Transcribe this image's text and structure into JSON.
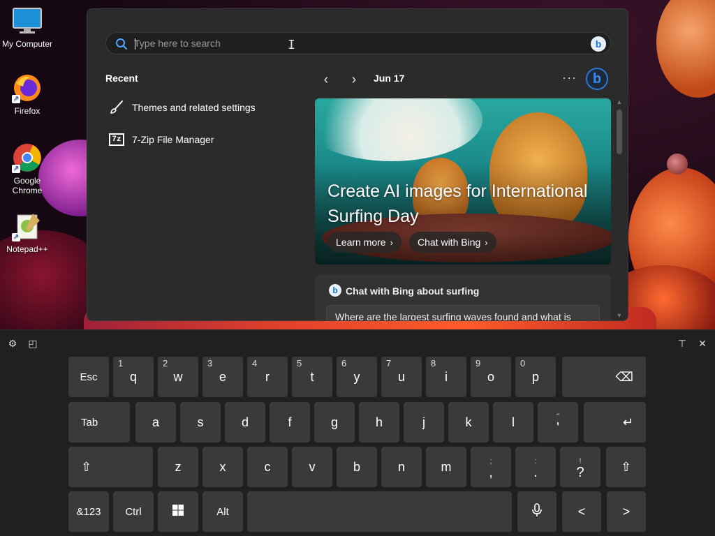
{
  "desktop": {
    "icons": [
      {
        "label": "My Computer"
      },
      {
        "label": "Firefox"
      },
      {
        "label": "Google Chrome"
      },
      {
        "label": "Notepad++"
      }
    ]
  },
  "start_menu": {
    "search": {
      "placeholder": "Type here to search",
      "value": ""
    },
    "recent": {
      "title": "Recent",
      "items": [
        {
          "label": "Themes and related settings",
          "icon": "brush-icon"
        },
        {
          "label": "7-Zip File Manager",
          "icon": "7zip-icon",
          "icon_text": "7z"
        }
      ]
    },
    "highlights": {
      "date": "Jun 17",
      "more_label": "···",
      "hero": {
        "title": "Create AI images for International Surfing Day",
        "learn_more": "Learn more",
        "chat_with_bing": "Chat with Bing"
      },
      "chat_card": {
        "title": "Chat with Bing about surfing",
        "prompt": "Where are the largest surfing waves found and what is"
      }
    }
  },
  "keyboard": {
    "row1": [
      {
        "label": "Esc"
      },
      {
        "label": "q",
        "sub": "1"
      },
      {
        "label": "w",
        "sub": "2"
      },
      {
        "label": "e",
        "sub": "3"
      },
      {
        "label": "r",
        "sub": "4"
      },
      {
        "label": "t",
        "sub": "5"
      },
      {
        "label": "y",
        "sub": "6"
      },
      {
        "label": "u",
        "sub": "7"
      },
      {
        "label": "i",
        "sub": "8"
      },
      {
        "label": "o",
        "sub": "9"
      },
      {
        "label": "p",
        "sub": "0"
      },
      {
        "label": "⌫",
        "icon": "backspace-icon"
      }
    ],
    "row2": [
      {
        "label": "Tab"
      },
      {
        "label": "a"
      },
      {
        "label": "s"
      },
      {
        "label": "d"
      },
      {
        "label": "f"
      },
      {
        "label": "g"
      },
      {
        "label": "h"
      },
      {
        "label": "j"
      },
      {
        "label": "k"
      },
      {
        "label": "l"
      },
      {
        "label": "'",
        "up": "\""
      },
      {
        "label": "↵",
        "icon": "enter-icon"
      }
    ],
    "row3": [
      {
        "label": "⇧",
        "icon": "shift-icon"
      },
      {
        "label": "z"
      },
      {
        "label": "x"
      },
      {
        "label": "c"
      },
      {
        "label": "v"
      },
      {
        "label": "b"
      },
      {
        "label": "n"
      },
      {
        "label": "m"
      },
      {
        "label": ",",
        "up": ";"
      },
      {
        "label": ".",
        "up": ":"
      },
      {
        "label": "?",
        "up": "!"
      },
      {
        "label": "⇧",
        "icon": "shift-icon"
      }
    ],
    "row4": [
      {
        "label": "&123"
      },
      {
        "label": "Ctrl"
      },
      {
        "label": "⊞",
        "icon": "windows-icon"
      },
      {
        "label": "Alt"
      },
      {
        "label": "",
        "icon": "space-bar"
      },
      {
        "label": "🎙",
        "icon": "microphone-icon"
      },
      {
        "label": "<"
      },
      {
        "label": ">"
      }
    ]
  }
}
